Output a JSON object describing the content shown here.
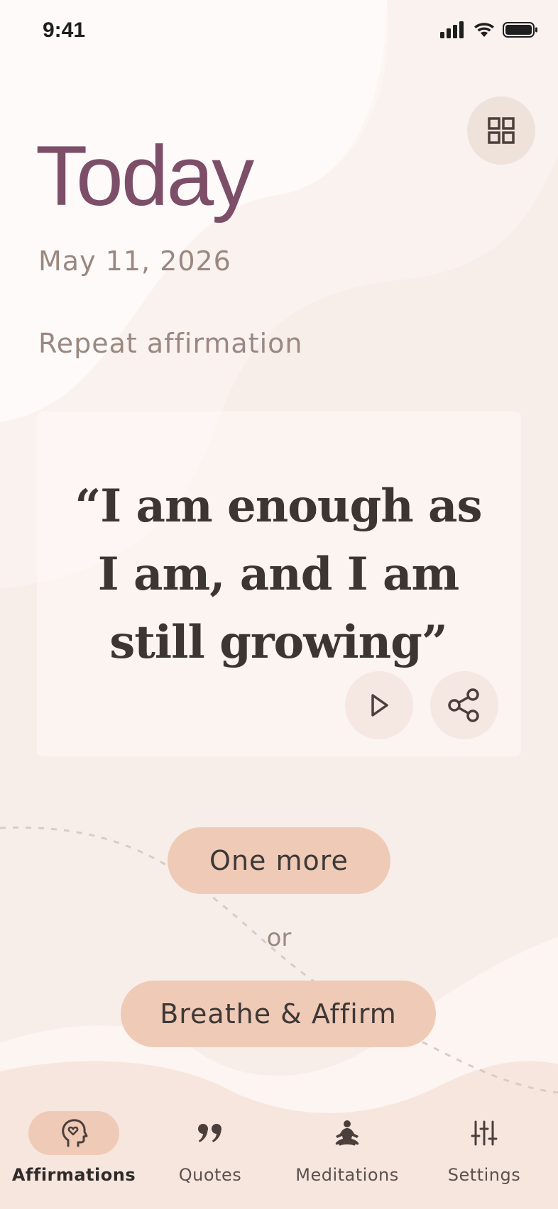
{
  "status_bar": {
    "time": "9:41",
    "icons": [
      "cellular-signal-icon",
      "wifi-icon",
      "battery-icon"
    ]
  },
  "header": {
    "title": "Today",
    "date": "May 11, 2026",
    "grid_icon": "grid-icon"
  },
  "section_label": "Repeat affirmation",
  "affirmation": {
    "text": "“I am enough as I am, and I am still growing”",
    "actions": [
      "play-icon",
      "share-icon"
    ]
  },
  "actions": {
    "one_more": "One more",
    "or": "or",
    "breathe": "Breathe & Affirm"
  },
  "nav": {
    "items": [
      {
        "label": "Affirmations",
        "icon": "head-heart-icon",
        "active": true
      },
      {
        "label": "Quotes",
        "icon": "quote-icon",
        "active": false
      },
      {
        "label": "Meditations",
        "icon": "meditation-icon",
        "active": false
      },
      {
        "label": "Settings",
        "icon": "sliders-icon",
        "active": false
      }
    ]
  },
  "colors": {
    "background": "#f8eee9",
    "title": "#7c4e68",
    "button": "#efcbb7",
    "text_dark": "#3c3532",
    "text_muted": "#9a8880"
  }
}
